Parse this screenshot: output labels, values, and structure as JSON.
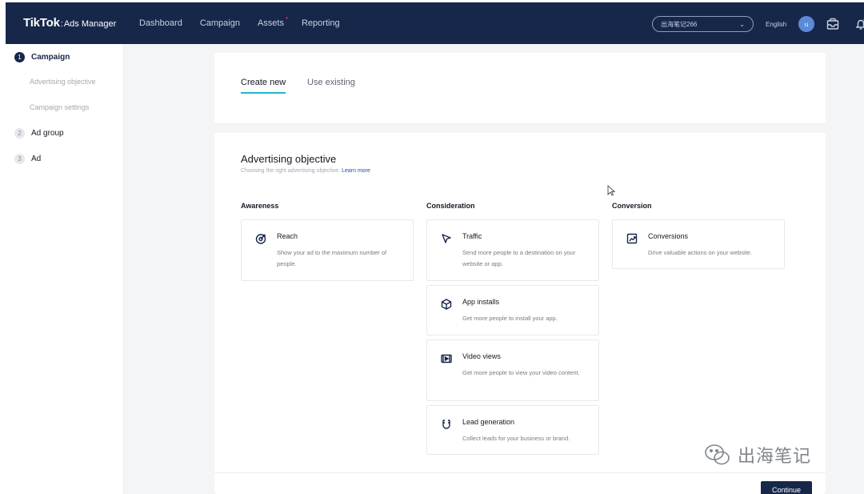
{
  "header": {
    "logo_main": "TikTok",
    "logo_sep": ":",
    "logo_sub": "Ads Manager",
    "nav": [
      "Dashboard",
      "Campaign",
      "Assets",
      "Reporting"
    ],
    "nav_dot": "•",
    "account": "出海笔记266",
    "account_chevron": "⌄",
    "language": "English",
    "avatar_initial": "u"
  },
  "sidebar": {
    "steps": [
      {
        "num": "1",
        "label": "Campaign"
      },
      {
        "num": "2",
        "label": "Ad group"
      },
      {
        "num": "3",
        "label": "Ad"
      }
    ],
    "substeps": [
      "Advertising objective",
      "Campaign settings"
    ]
  },
  "tabs": {
    "create": "Create new",
    "use": "Use existing"
  },
  "objective": {
    "title": "Advertising objective",
    "subtitle": "Choosing the right advertising objective.",
    "learn_more": "Learn more",
    "columns": [
      "Awareness",
      "Consideration",
      "Conversion"
    ],
    "options": {
      "reach": {
        "title": "Reach",
        "desc": "Show your ad to the maximum number of people.",
        "icon": "target-icon"
      },
      "traffic": {
        "title": "Traffic",
        "desc": "Send more people to a destination on your website or app.",
        "icon": "cursor-arrow-icon"
      },
      "app_installs": {
        "title": "App installs",
        "desc": "Get more people to install your app.",
        "icon": "cube-icon"
      },
      "video_views": {
        "title": "Video views",
        "desc": "Get more people to view your video content.",
        "icon": "video-icon"
      },
      "lead_generation": {
        "title": "Lead generation",
        "desc": "Collect leads for your business or brand.",
        "icon": "magnet-icon"
      },
      "conversions": {
        "title": "Conversions",
        "desc": "Drive valuable actions on your website.",
        "icon": "chart-up-icon"
      }
    }
  },
  "footer": {
    "continue": "Continue"
  },
  "watermark": "出海笔记",
  "colors": {
    "navy": "#16274a",
    "accent": "#1fb6c7",
    "link": "#1f4fa8"
  }
}
